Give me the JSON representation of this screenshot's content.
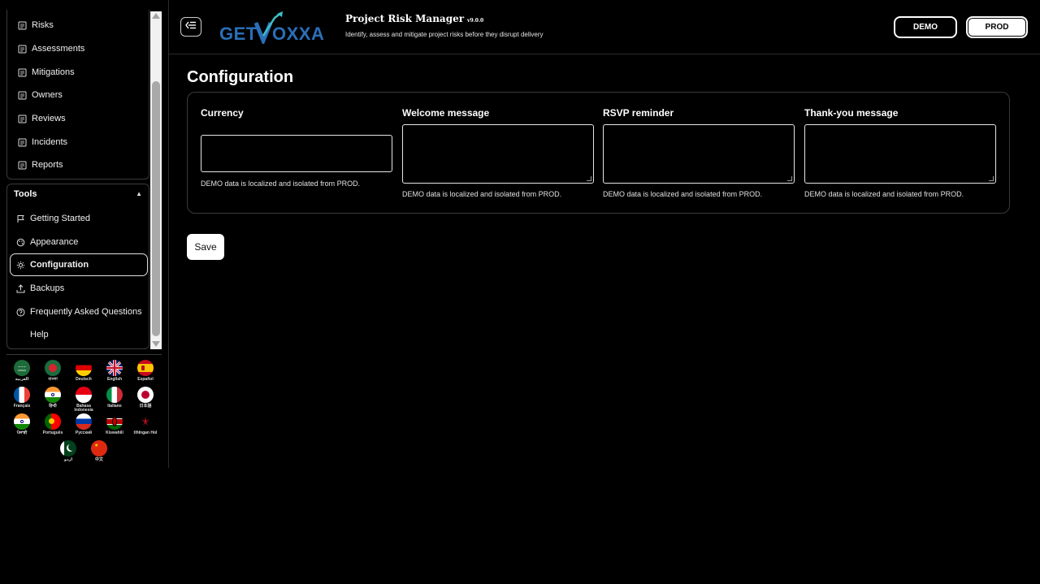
{
  "sidebar": {
    "nav_items": [
      {
        "label": "Risks",
        "icon": "document-icon"
      },
      {
        "label": "Assessments",
        "icon": "document-icon"
      },
      {
        "label": "Mitigations",
        "icon": "document-icon"
      },
      {
        "label": "Owners",
        "icon": "document-icon"
      },
      {
        "label": "Reviews",
        "icon": "document-icon"
      },
      {
        "label": "Incidents",
        "icon": "document-icon"
      },
      {
        "label": "Reports",
        "icon": "document-icon"
      }
    ],
    "tools_heading": "Tools",
    "tools_caret": "▲",
    "tools": [
      {
        "label": "Getting Started",
        "icon": "flag-icon"
      },
      {
        "label": "Appearance",
        "icon": "palette-icon"
      },
      {
        "label": "Configuration",
        "icon": "gear-icon",
        "active": true
      },
      {
        "label": "Backups",
        "icon": "upload-icon"
      },
      {
        "label": "Frequently Asked Questions",
        "icon": "question-icon"
      },
      {
        "label": "Help",
        "icon": ""
      }
    ],
    "languages": [
      {
        "label": "العربية",
        "flag": "saudi"
      },
      {
        "label": "বাংলা",
        "flag": "bangladesh"
      },
      {
        "label": "Deutsch",
        "flag": "germany"
      },
      {
        "label": "English",
        "flag": "uk"
      },
      {
        "label": "Español",
        "flag": "spain"
      },
      {
        "label": "Français",
        "flag": "france"
      },
      {
        "label": "हिन्दी",
        "flag": "india"
      },
      {
        "label": "Bahasa Indonesia",
        "flag": "indonesia"
      },
      {
        "label": "Italiano",
        "flag": "italy"
      },
      {
        "label": "日本語",
        "flag": "japan"
      },
      {
        "label": "ਪੰਜਾਬੀ",
        "flag": "india"
      },
      {
        "label": "Português",
        "flag": "portugal"
      },
      {
        "label": "Русский",
        "flag": "russia"
      },
      {
        "label": "Kiswahili",
        "flag": "kenya"
      },
      {
        "label": "tlhIngan Hol",
        "flag": "klingon"
      },
      {
        "label": "اردو",
        "flag": "pakistan"
      },
      {
        "label": "中文",
        "flag": "china"
      }
    ]
  },
  "header": {
    "logo_text": "GETVOXXA",
    "title": "Project Risk Manager",
    "version": "v9.0.0",
    "subtitle": "Identify, assess and mitigate project risks before they disrupt delivery",
    "env_demo": "DEMO",
    "env_prod": "PROD"
  },
  "main": {
    "page_title": "Configuration",
    "fields": [
      {
        "label": "Currency",
        "value": "",
        "help": "DEMO data is localized and isolated from PROD."
      },
      {
        "label": "Welcome message",
        "value": "",
        "help": "DEMO data is localized and isolated from PROD."
      },
      {
        "label": "RSVP reminder",
        "value": "",
        "help": "DEMO data is localized and isolated from PROD."
      },
      {
        "label": "Thank-you message",
        "value": "",
        "help": "DEMO data is localized and isolated from PROD."
      }
    ],
    "save_label": "Save"
  },
  "colors": {
    "background": "#000000",
    "border": "#3a3a3a",
    "logo_blue": "#2a6fb8",
    "logo_accent": "#3fc0c8"
  }
}
